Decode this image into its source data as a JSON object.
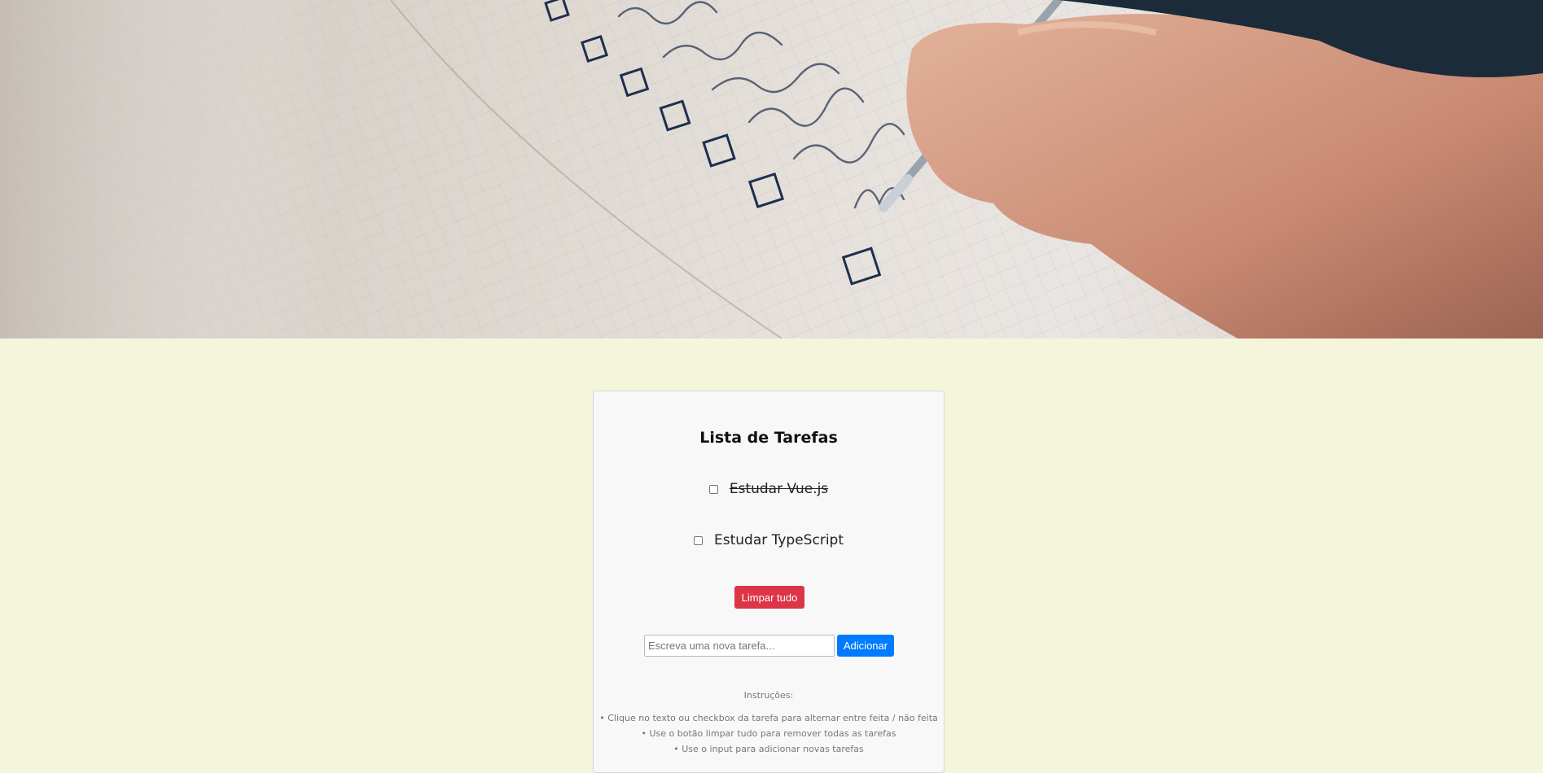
{
  "hero": {
    "image": "notebook-checklist-photo"
  },
  "card": {
    "title": "Lista de Tarefas",
    "tasks": [
      {
        "label": "Estudar Vue.js",
        "done": true
      },
      {
        "label": "Estudar TypeScript",
        "done": false
      }
    ],
    "clear_label": "Limpar tudo",
    "input_placeholder": "Escreva uma nova tarefa...",
    "add_label": "Adicionar",
    "instructions_title": "Instruções:",
    "instructions": [
      "Clique no texto ou checkbox da tarefa para alternar entre feita / não feita",
      "Use o botão limpar tudo para remover todas as tarefas",
      "Use o input para adicionar novas tarefas"
    ]
  },
  "colors": {
    "page_bg": "#f5f5dc",
    "danger": "#dc3545",
    "primary": "#007bff"
  }
}
